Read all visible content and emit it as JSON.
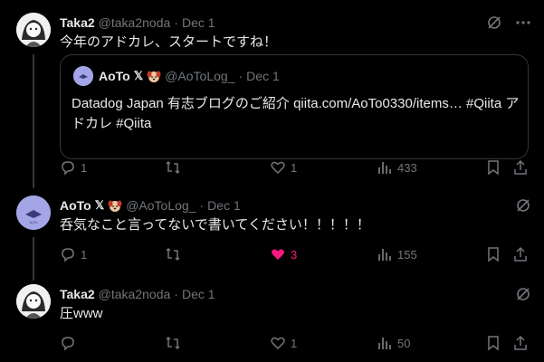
{
  "posts": [
    {
      "name": "Taka2",
      "handle": "@taka2noda",
      "dot": "·",
      "date": "Dec 1",
      "text": "今年のアドカレ、スタートですね！",
      "quote": {
        "name": "AoTo",
        "x_badge": "𝕏",
        "handle": "@AoToLog_",
        "dot": "·",
        "date": "Dec 1",
        "text": "Datadog Japan 有志ブログのご紹介 qiita.com/AoTo0330/items… #Qiita アドカレ #Qiita"
      },
      "actions": {
        "replies": "1",
        "retweets": "",
        "likes": "1",
        "views": "433"
      }
    },
    {
      "name": "AoTo",
      "x_badge": "𝕏",
      "handle": "@AoToLog_",
      "dot": "·",
      "date": "Dec 1",
      "text": "呑気なこと言ってないで書いてください！！！！！",
      "actions": {
        "replies": "1",
        "retweets": "",
        "likes": "3",
        "views": "155"
      }
    },
    {
      "name": "Taka2",
      "handle": "@taka2noda",
      "dot": "·",
      "date": "Dec 1",
      "text": "圧www",
      "actions": {
        "replies": "",
        "retweets": "",
        "likes": "1",
        "views": "50"
      }
    }
  ],
  "colors": {
    "background": "#000000",
    "muted": "#71767b",
    "like": "#f91880",
    "border": "#333639"
  }
}
